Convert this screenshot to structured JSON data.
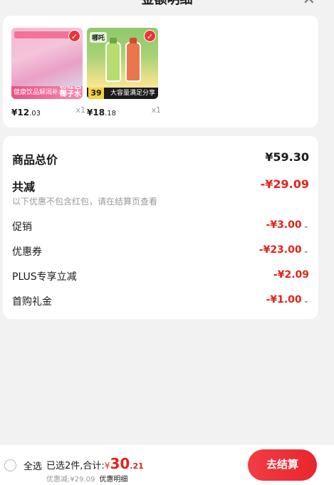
{
  "header": {
    "title": "金额明细",
    "close_icon": "close-icon"
  },
  "products": [
    {
      "image_text": "健康饮品解渴补水",
      "image_tag": "粉红色\n椰子水",
      "price_int": "¥12",
      "price_dec": ".03",
      "qty": "x1"
    },
    {
      "brand": "哪吒",
      "promo_num": "39",
      "image_text": "大容量满足分享",
      "price_int": "¥18",
      "price_dec": ".18",
      "qty": "x1"
    }
  ],
  "summary": {
    "total_label": "商品总价",
    "total_value": "¥59.30",
    "discount_label": "共减",
    "discount_value": "-¥29.09",
    "note": "以下优惠不包含红包，请在结算页查看",
    "items": [
      {
        "label": "促销",
        "value": "-¥3.00",
        "expandable": true
      },
      {
        "label": "优惠券",
        "value": "-¥23.00",
        "expandable": true
      },
      {
        "label": "PLUS专享立减",
        "value": "-¥2.09",
        "expandable": false
      },
      {
        "label": "首购礼金",
        "value": "-¥1.00",
        "expandable": true
      }
    ]
  },
  "bottom": {
    "select_all": "全选",
    "selected_text": "已选2件,合计:",
    "currency": "¥",
    "amount_int": "30",
    "amount_dec": ".21",
    "discount_sub": "优惠减:¥29.09",
    "detail_link": "优惠明细",
    "checkout_label": "去结算"
  },
  "colors": {
    "accent": "#e2231a",
    "button": "#e8262f"
  }
}
